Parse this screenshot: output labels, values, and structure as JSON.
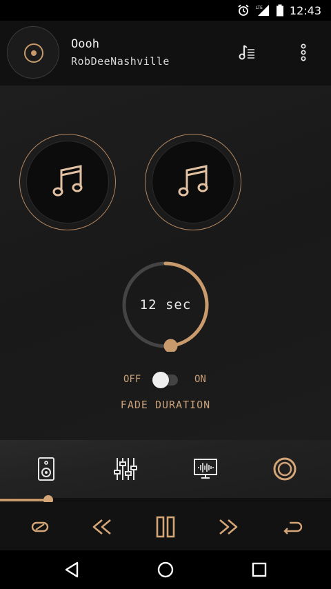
{
  "status_bar": {
    "time": "12:43",
    "network": "LTE",
    "icons": [
      "alarm-icon",
      "signal-icon",
      "battery-icon"
    ]
  },
  "now_playing": {
    "title": "Oooh",
    "artist": "RobDeeNashville"
  },
  "decks": [
    {
      "icon": "music-note-icon"
    },
    {
      "icon": "music-note-icon"
    }
  ],
  "crossfade": {
    "value_text": "12 sec",
    "off_label": "OFF",
    "on_label": "ON",
    "toggle_on": false,
    "label": "FADE DURATION",
    "dial_fraction": 0.48
  },
  "tabs": [
    {
      "icon": "speaker-icon"
    },
    {
      "icon": "equalizer-icon"
    },
    {
      "icon": "visualizer-icon"
    },
    {
      "icon": "crossfade-icon",
      "active": true
    }
  ],
  "playback": {
    "progress_fraction": 0.145
  },
  "transport": [
    {
      "icon": "shuffle-icon"
    },
    {
      "icon": "rewind-icon"
    },
    {
      "icon": "pause-icon"
    },
    {
      "icon": "fast-forward-icon"
    },
    {
      "icon": "repeat-icon"
    }
  ],
  "colors": {
    "accent": "#c99a6c",
    "background": "#1a1a1a",
    "header": "#111111"
  }
}
